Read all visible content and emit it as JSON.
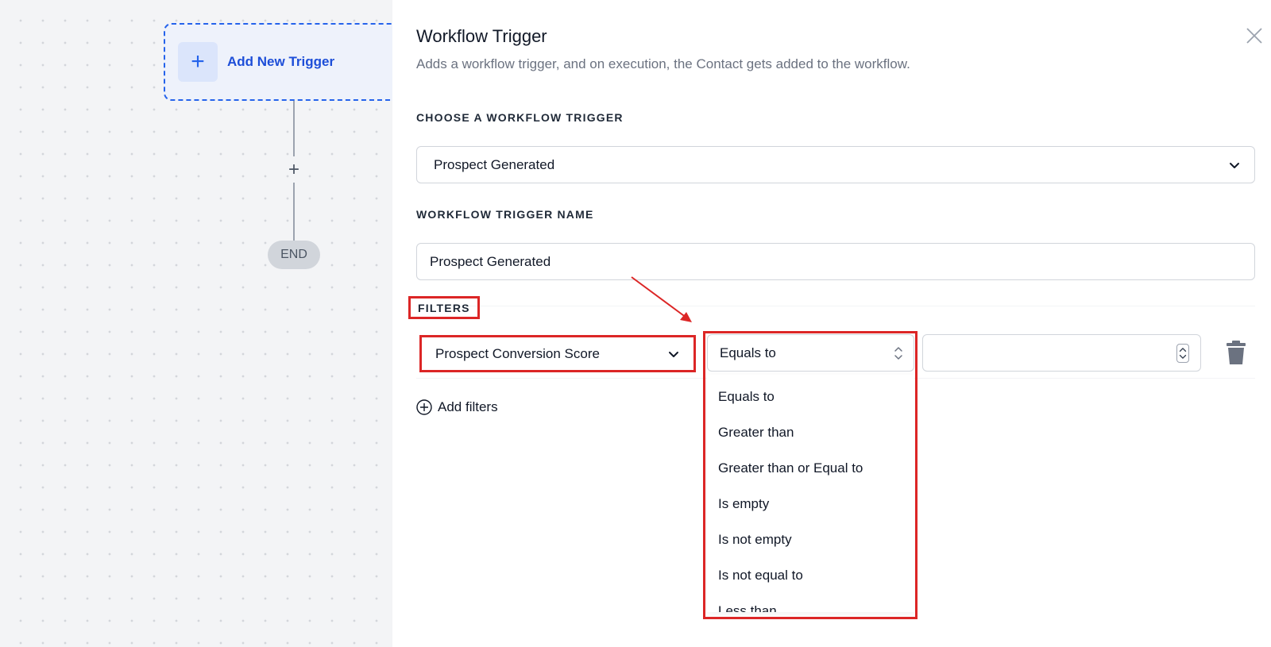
{
  "canvas": {
    "trigger_card_label": "Add New Trigger",
    "end_label": "END"
  },
  "panel": {
    "title": "Workflow Trigger",
    "subtitle": "Adds a workflow trigger, and on execution, the Contact gets added to the workflow.",
    "choose_label": "CHOOSE A WORKFLOW TRIGGER",
    "trigger_value": "Prospect Generated",
    "name_label": "WORKFLOW TRIGGER NAME",
    "name_value": "Prospect Generated",
    "filters_label": "FILTERS",
    "filter": {
      "field_value": "Prospect Conversion Score",
      "operator_value": "Equals to",
      "operator_options": [
        "Equals to",
        "Greater than",
        "Greater than or Equal to",
        "Is empty",
        "Is not empty",
        "Is not equal to",
        "Less than"
      ],
      "value": ""
    },
    "add_filters_label": "Add filters"
  },
  "icons": {
    "close": "close-icon",
    "chevron": "chevron-down-icon",
    "trash": "trash-icon",
    "add": "plus-circle-icon"
  },
  "colors": {
    "accent": "#2563eb",
    "highlight": "#dc2626"
  }
}
